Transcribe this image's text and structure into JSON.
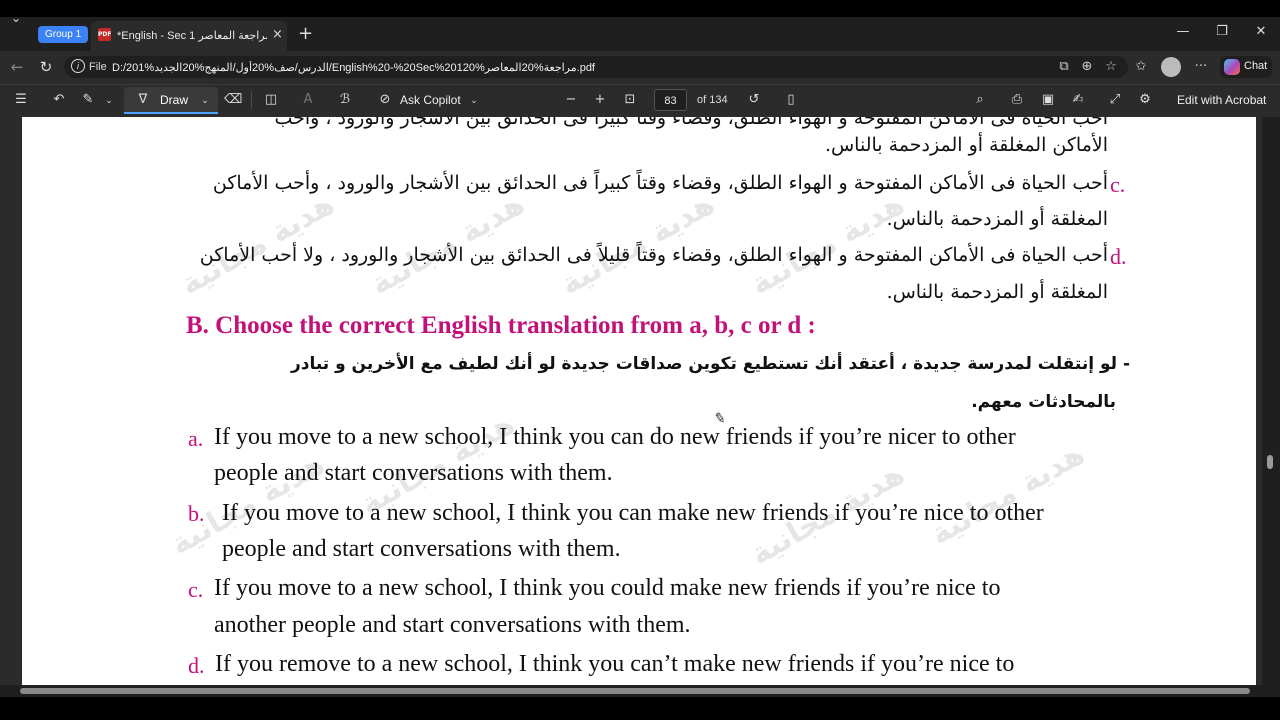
{
  "browser": {
    "group_label": "Group 1",
    "tab_title": "*English - Sec 1 مراجعة المعاصر.pdf",
    "tab_close": "×",
    "new_tab": "+",
    "menu_glyph": "⌄",
    "win_minimize": "—",
    "win_restore": "❐",
    "win_close": "✕",
    "back": "←",
    "refresh": "↻",
    "file_label": "File",
    "url": "D:/201%الدرس/صف%20أول/المنهج%20الجديد/English%20-%20Sec%20120%مراجعة%20المعاصر.pdf",
    "chat_label": "Chat",
    "more": "···",
    "icons": [
      "reader-icon",
      "zoom-icon",
      "star-icon",
      "favorites-icon",
      "profile-avatar",
      "more-icon",
      "copilot-icon"
    ]
  },
  "pdf_toolbar": {
    "draw_label": "Draw",
    "ask_copilot_label": "Ask Copilot",
    "page_current": "83",
    "page_total": "of 134",
    "edit_acrobat_label": "Edit with Acrobat",
    "zoom_out": "−",
    "zoom_in": "+"
  },
  "document": {
    "arabic_lines": [
      "أحب الحياة فى الأماكن المفتوحة و الهواء الطلق، وقضاء وقتاً كبيراً فى الحدائق بين الأشجار والورود ، وأحب",
      "الأماكن المغلقة أو المزدحمة بالناس.",
      "أحب الحياة فى الأماكن المفتوحة و الهواء الطلق، وقضاء  وقتاً كبيراً فى الحدائق بين الأشجار والورود ، وأحب الأماكن",
      "المغلقة أو المزدحمة بالناس.",
      "أحب الحياة فى الأماكن المفتوحة و الهواء الطلق، وقضاء  وقتاً قليلاً  فى الحدائق بين الأشجار والورود ، ولا أحب الأماكن",
      "المغلقة أو المزدحمة بالناس."
    ],
    "letters_top": [
      "c.",
      "d."
    ],
    "section_title": "B. Choose the correct English translation from a, b, c or d :",
    "arabic_question_1": "- لو إنتقلت لمدرسة جديدة ، أعتقد أنك تستطيع تكوين صداقات جديدة لو أنك لطيف مع الأخرين و تبادر",
    "arabic_question_2": "بالمحادثات معهم.",
    "options": [
      {
        "letter": "a.",
        "line1": "If you move to a new school, I think you can do new friends if you’re nicer to other",
        "line2": "people and start conversations with them."
      },
      {
        "letter": "b.",
        "line1": "If you move to a new school, I think you can make new friends if you’re nice to other",
        "line2": "people and start conversations with them."
      },
      {
        "letter": "c.",
        "line1": "If you move to a new school, I think you could make new friends if you’re nice to",
        "line2": "another people and start conversations with them."
      },
      {
        "letter": "d.",
        "line1": "If you remove to a new school, I think you can’t make new friends if you’re nice to",
        "line2": ""
      }
    ],
    "watermark_text": "هدية مجانية",
    "accent_color": "#c2127a"
  }
}
